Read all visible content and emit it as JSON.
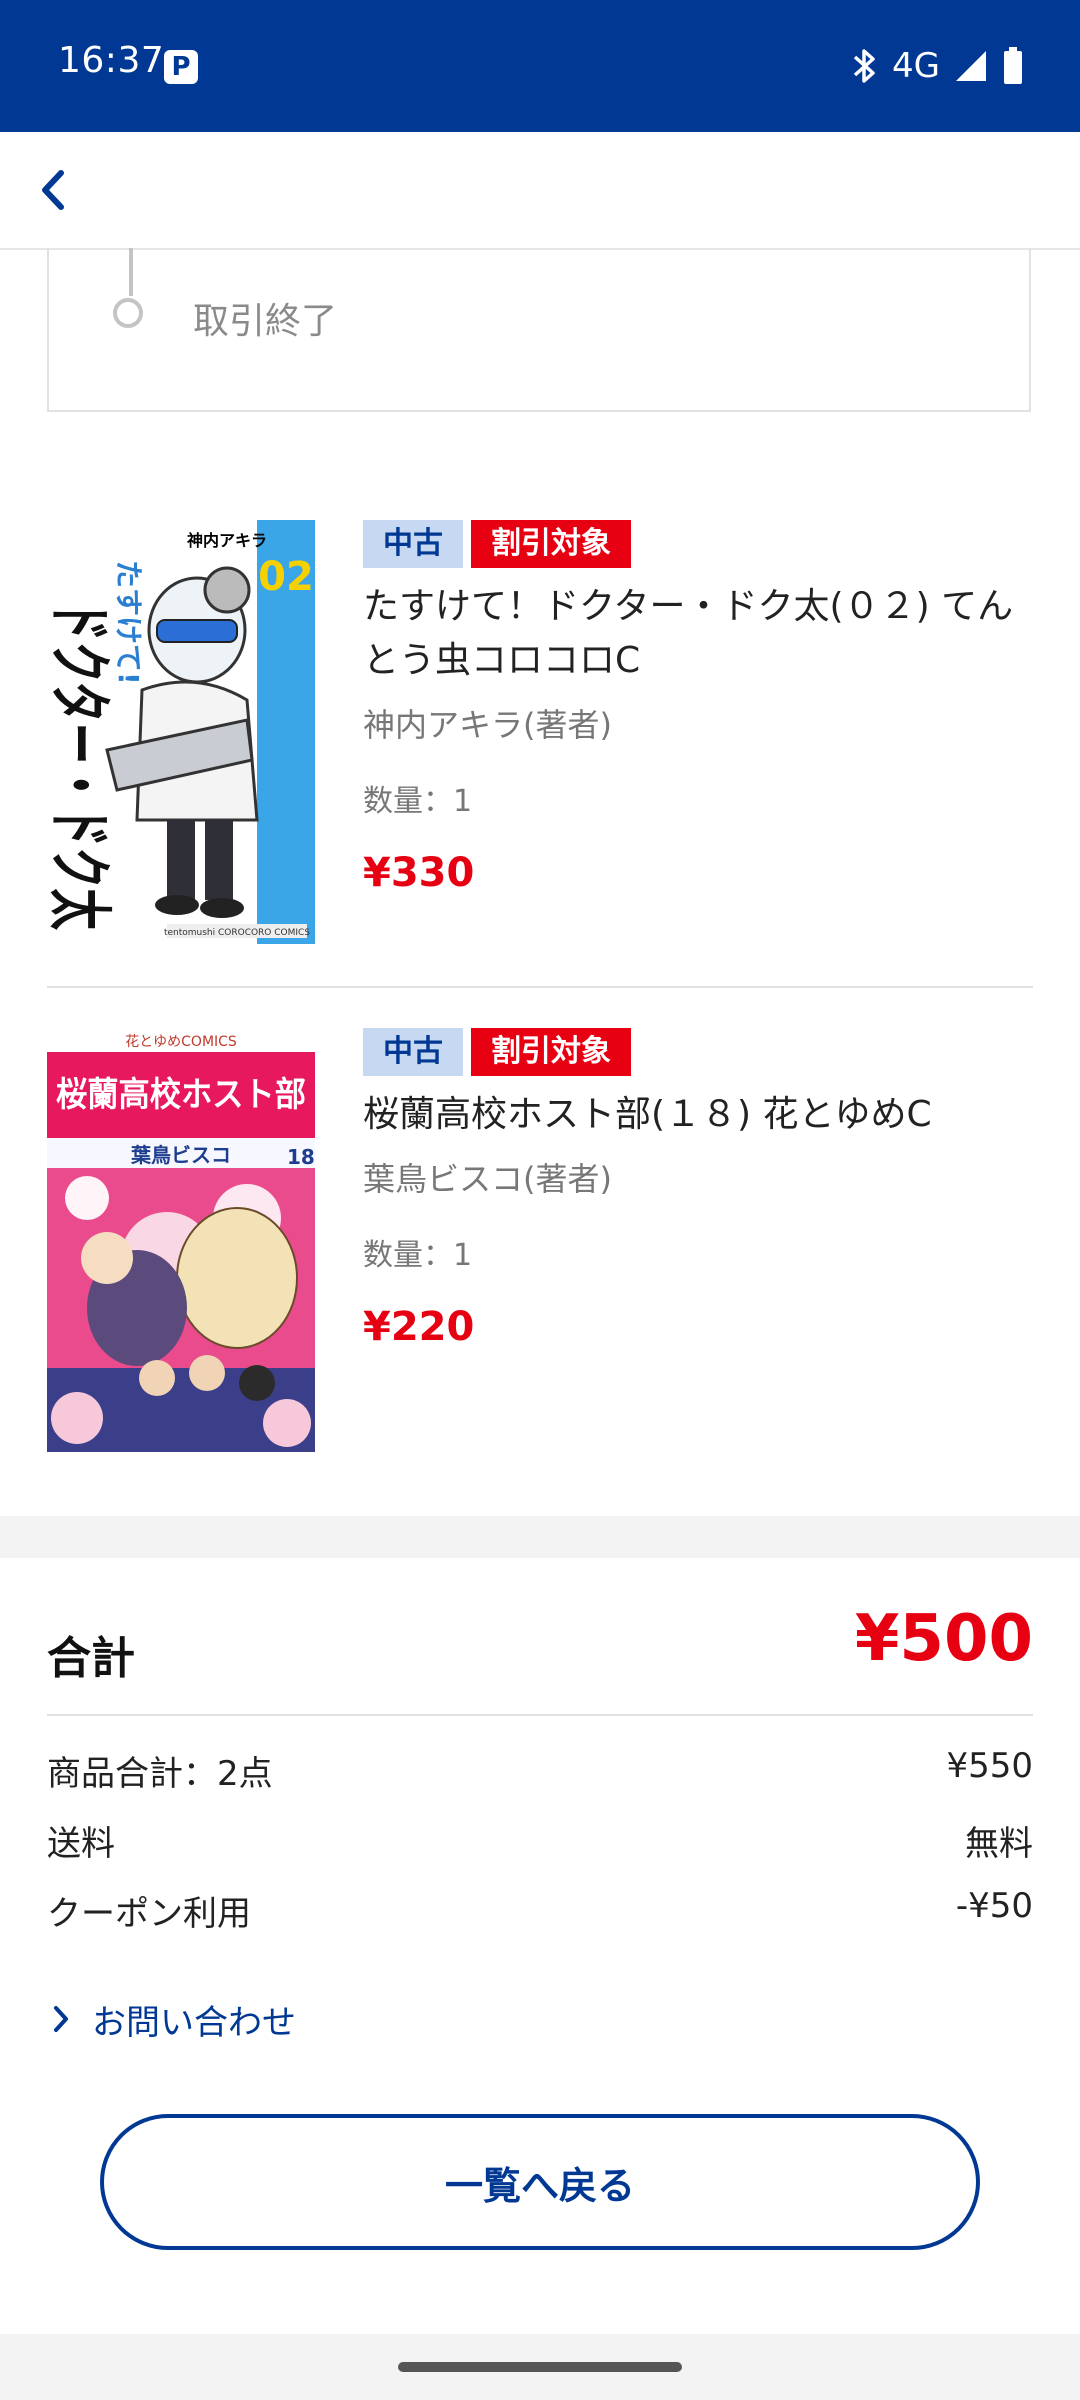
{
  "status_bar": {
    "time": "16:37",
    "notification_icon": "P",
    "network": "4G"
  },
  "header": {
    "back_icon": "chevron-left"
  },
  "tracker": {
    "last_step_label": "取引終了"
  },
  "items": [
    {
      "badge_condition": "中古",
      "badge_discount": "割引対象",
      "title": "たすけて！ドクター・ドク太(０２) てんとう虫コロコロC",
      "author": "神内アキラ(著者)",
      "quantity": "数量：1",
      "price": "¥330",
      "cover_text": {
        "author": "神内アキラ",
        "volume": "02",
        "series": "たすけて!",
        "title": "ドクター・ドク太",
        "publisher": "tentomushi COROCORO COMICS"
      }
    },
    {
      "badge_condition": "中古",
      "badge_discount": "割引対象",
      "title": "桜蘭高校ホスト部(１８) 花とゆめC",
      "author": "葉鳥ビスコ(著者)",
      "quantity": "数量：1",
      "price": "¥220",
      "cover_text": {
        "label": "花とゆめCOMICS",
        "title": "桜蘭高校ホスト部",
        "author": "葉鳥ビスコ",
        "volume": "18"
      }
    }
  ],
  "summary": {
    "total_label": "合計",
    "total_value": "¥500",
    "rows": [
      {
        "label": "商品合計：2点",
        "value": "¥550"
      },
      {
        "label": "送料",
        "value": "無料"
      },
      {
        "label": "クーポン利用",
        "value": "-¥50"
      }
    ]
  },
  "contact_link": "お問い合わせ",
  "back_to_list_button": "一覧へ戻る",
  "colors": {
    "brand": "#003893",
    "accent_red": "#e60012",
    "badge_used_bg": "#c7d8f2"
  }
}
